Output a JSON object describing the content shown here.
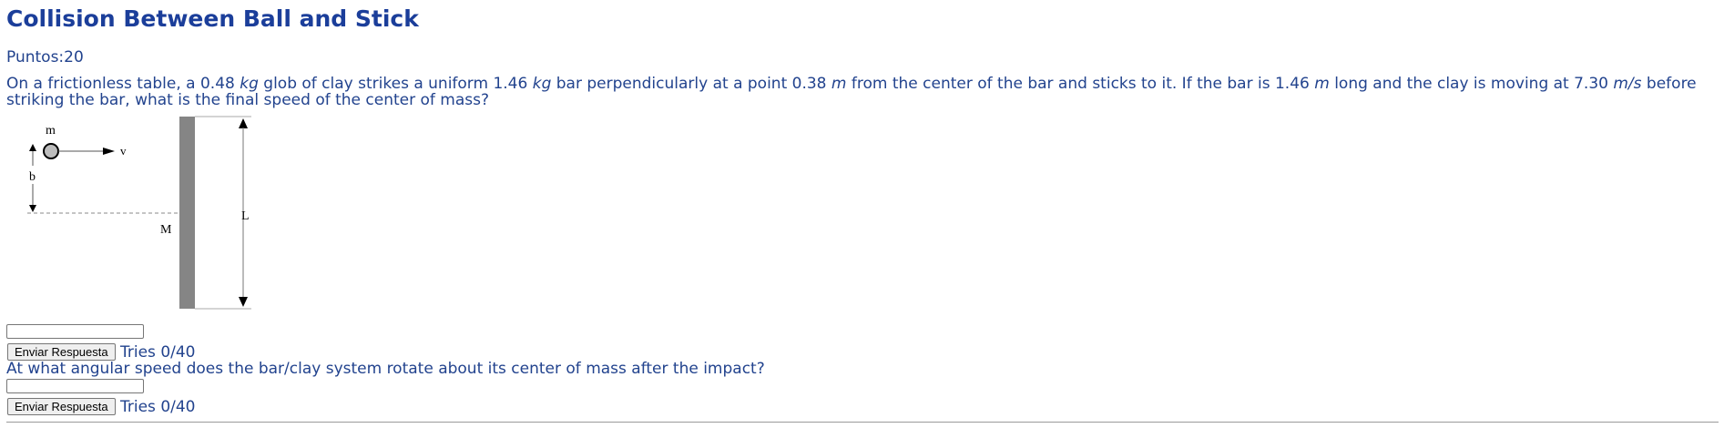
{
  "title": "Collision Between Ball and Stick",
  "points": {
    "label": "Puntos:",
    "value": "20"
  },
  "problem": {
    "part1": "On a frictionless table, a 0.48 ",
    "unit_kg1": "kg",
    "part2": " glob of clay strikes a uniform 1.46 ",
    "unit_kg2": "kg",
    "part3": " bar perpendicularly at a point 0.38 ",
    "unit_m1": "m",
    "part4": " from the center of the bar and sticks to it. If the bar is 1.46 ",
    "unit_m2": "m",
    "part5": " long and the clay is moving at 7.30 ",
    "unit_ms": "m/s",
    "part6": " before striking the bar, what is the final speed of the center of mass?"
  },
  "diagram": {
    "label_m": "m",
    "label_v": "v",
    "label_b": "b",
    "label_M": "M",
    "label_L": "L",
    "bar_color": "#858585",
    "ball_color": "#bdbdbd"
  },
  "part1_answer": {
    "value": "",
    "button_label": "Enviar Respuesta",
    "tries": "Tries 0/40"
  },
  "question2": "At what angular speed does the bar/clay system rotate about its center of mass after the impact?",
  "part2_answer": {
    "value": "",
    "button_label": "Enviar Respuesta",
    "tries": "Tries 0/40"
  }
}
